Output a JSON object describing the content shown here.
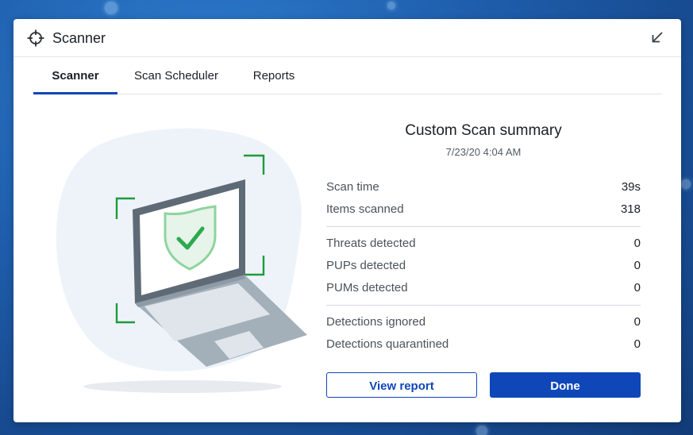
{
  "window": {
    "title": "Scanner"
  },
  "tabs": [
    {
      "label": "Scanner",
      "active": true
    },
    {
      "label": "Scan Scheduler",
      "active": false
    },
    {
      "label": "Reports",
      "active": false
    }
  ],
  "summary": {
    "title": "Custom Scan summary",
    "date": "7/23/20 4:04 AM",
    "groups": [
      [
        {
          "label": "Scan time",
          "value": "39s"
        },
        {
          "label": "Items scanned",
          "value": "318"
        }
      ],
      [
        {
          "label": "Threats detected",
          "value": "0"
        },
        {
          "label": "PUPs detected",
          "value": "0"
        },
        {
          "label": "PUMs detected",
          "value": "0"
        }
      ],
      [
        {
          "label": "Detections ignored",
          "value": "0"
        },
        {
          "label": "Detections quarantined",
          "value": "0"
        }
      ]
    ]
  },
  "buttons": {
    "view_report": "View report",
    "done": "Done"
  },
  "icons": {
    "title": "crosshair-icon",
    "minimize": "arrow-down-left-icon",
    "illustration": "laptop-shield-check-icon"
  },
  "colors": {
    "accent": "#0f47b8",
    "shield_green": "#2fa84f",
    "frame_green": "#1f9a3c"
  }
}
